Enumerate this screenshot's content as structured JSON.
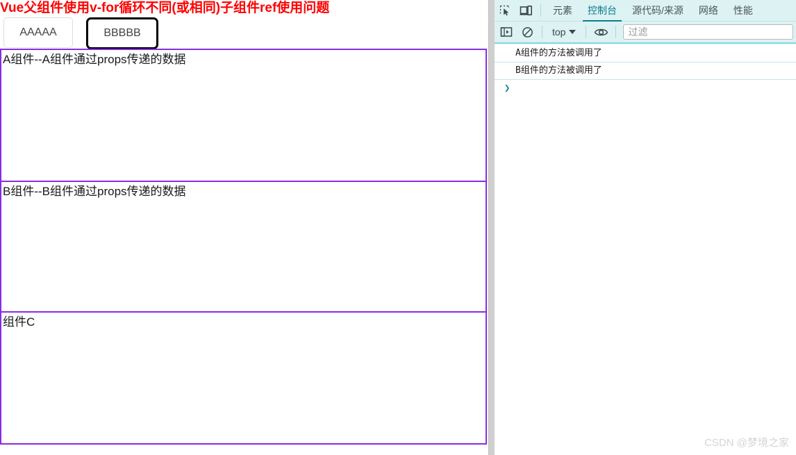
{
  "page": {
    "title": "Vue父组件使用v-for循环不同(或相同)子组件ref使用问题",
    "buttons": [
      {
        "name": "button-aaaaa",
        "label": "AAAAA",
        "focused": false
      },
      {
        "name": "button-bbbbb",
        "label": "BBBBB",
        "focused": true
      }
    ],
    "components": [
      {
        "id": "comp-a",
        "text": "A组件--A组件通过props传递的数据"
      },
      {
        "id": "comp-b",
        "text": "B组件--B组件通过props传递的数据"
      },
      {
        "id": "comp-c",
        "text": "组件C"
      }
    ],
    "border_color": "#8a2be2",
    "title_color": "#ff0000"
  },
  "devtools": {
    "icons": {
      "inspect": "inspect-element-icon",
      "device": "device-toolbar-icon",
      "sidebar": "console-sidebar-icon",
      "clear": "clear-console-icon",
      "eye": "live-expression-icon"
    },
    "tabs": [
      {
        "label": "元素",
        "active": false
      },
      {
        "label": "控制台",
        "active": true
      },
      {
        "label": "源代码/来源",
        "active": false
      },
      {
        "label": "网络",
        "active": false
      },
      {
        "label": "性能",
        "active": false
      }
    ],
    "toolbar": {
      "context_label": "top",
      "filter_placeholder": "过滤",
      "filter_value": ""
    },
    "console_messages": [
      "A组件的方法被调用了",
      "B组件的方法被调用了"
    ],
    "prompt_symbol": "❯",
    "accent_color": "#0a7b8c",
    "tabbar_background": "#ddf2f3"
  },
  "watermark": "CSDN @梦境之家"
}
